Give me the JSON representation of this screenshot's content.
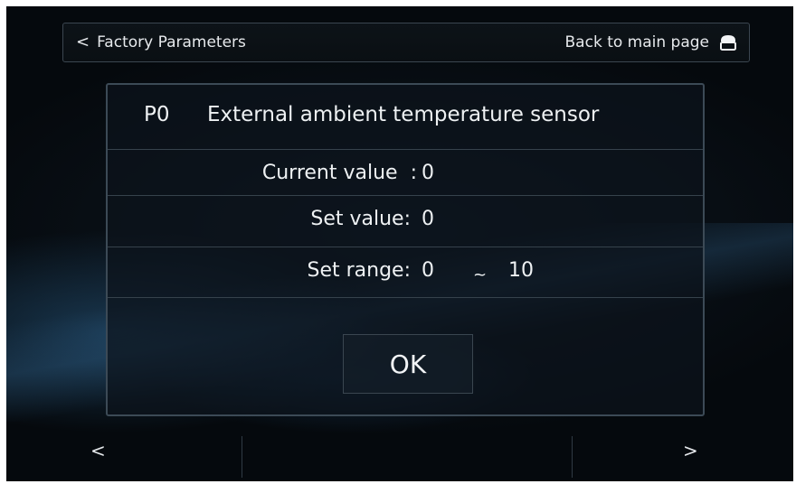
{
  "header": {
    "back_icon": "chevron-left-icon",
    "back_label": "Factory Parameters",
    "home_label": "Back to main page",
    "home_icon": "home-icon"
  },
  "param": {
    "code": "P0",
    "name": "External ambient temperature sensor",
    "current_label": "Current value  :",
    "current_value": "0",
    "set_label": "Set value:",
    "set_value": "0",
    "range_label": "Set range:",
    "range_min": "0",
    "range_sep": "~",
    "range_max": "10"
  },
  "ok_label": "OK",
  "footer": {
    "prev_icon": "chevron-left-icon",
    "prev_label": "<",
    "next_icon": "chevron-right-icon",
    "next_label": ">"
  }
}
